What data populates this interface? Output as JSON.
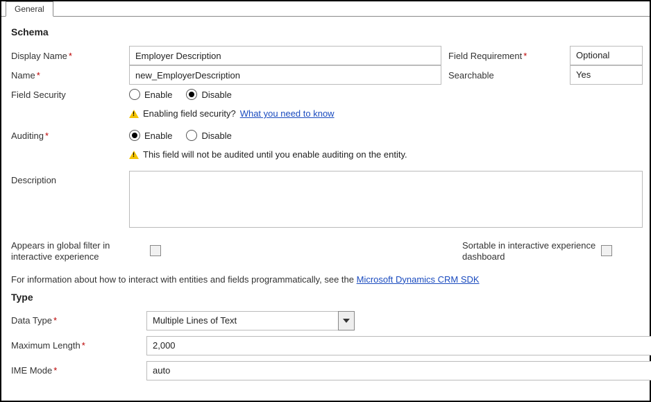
{
  "tabs": {
    "general": "General"
  },
  "schema": {
    "heading": "Schema",
    "display_name_label": "Display Name",
    "display_name_value": "Employer Description",
    "field_requirement_label": "Field Requirement",
    "field_requirement_value": "Optional",
    "name_label": "Name",
    "name_value": "new_EmployerDescription",
    "searchable_label": "Searchable",
    "searchable_value": "Yes",
    "field_security_label": "Field Security",
    "field_security_enable": "Enable",
    "field_security_disable": "Disable",
    "field_security_selected": "Disable",
    "field_security_warn": "Enabling field security?",
    "field_security_link": "What you need to know",
    "auditing_label": "Auditing",
    "auditing_enable": "Enable",
    "auditing_disable": "Disable",
    "auditing_selected": "Enable",
    "auditing_warn": "This field will not be audited until you enable auditing on the entity.",
    "description_label": "Description",
    "description_value": "",
    "appears_label": "Appears in global filter in interactive experience",
    "appears_checked": false,
    "sortable_label": "Sortable in interactive experience dashboard",
    "sortable_checked": false,
    "info_text": "For information about how to interact with entities and fields programmatically, see the ",
    "info_link": "Microsoft Dynamics CRM SDK"
  },
  "type": {
    "heading": "Type",
    "data_type_label": "Data Type",
    "data_type_value": "Multiple Lines of Text",
    "max_length_label": "Maximum Length",
    "max_length_value": "2,000",
    "ime_mode_label": "IME Mode",
    "ime_mode_value": "auto"
  }
}
